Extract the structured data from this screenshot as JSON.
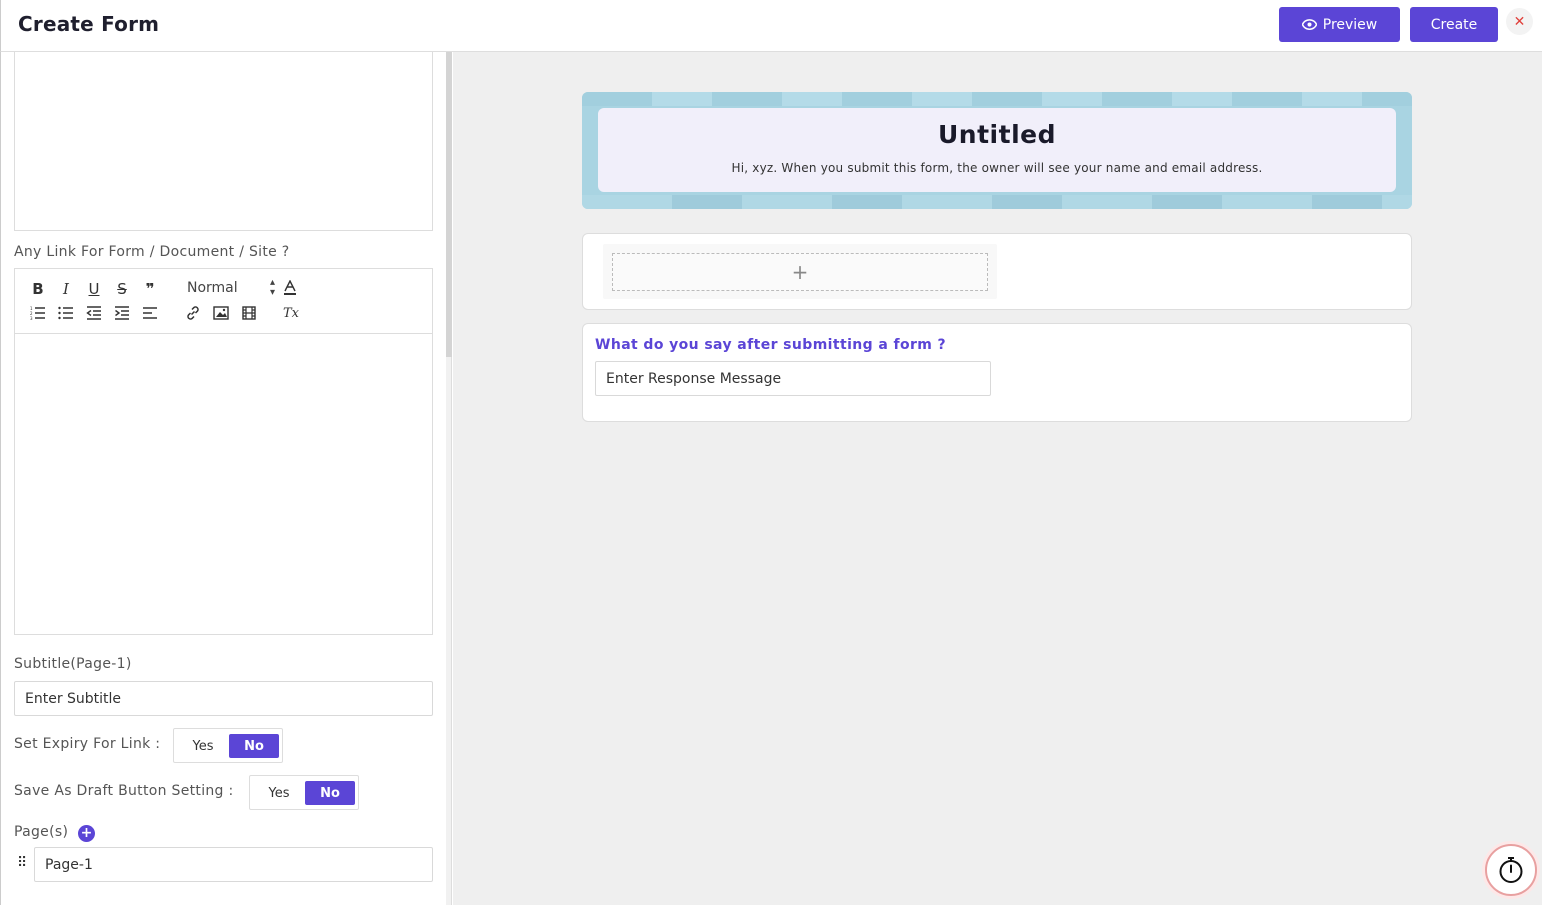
{
  "header": {
    "title": "Create Form",
    "preview_label": "Preview",
    "create_label": "Create",
    "close_glyph": "✕"
  },
  "sidebar": {
    "link_label": "Any Link For Form / Document / Site ?",
    "toolbar": {
      "bold": "B",
      "italic": "I",
      "underline": "U",
      "strike": "S",
      "quote": "❞",
      "format_select": "Normal",
      "clear_format": "Tx",
      "icons": [
        "bold-icon",
        "italic-icon",
        "underline-icon",
        "strikethrough-icon",
        "blockquote-icon",
        "font-color-icon",
        "ordered-list-icon",
        "bullet-list-icon",
        "outdent-icon",
        "indent-icon",
        "align-icon",
        "link-icon",
        "image-icon",
        "video-icon",
        "clear-format-icon"
      ]
    },
    "subtitle_label": "Subtitle(Page-1)",
    "subtitle_placeholder": "Enter Subtitle",
    "expiry_label": "Set Expiry For Link :",
    "expiry_yes": "Yes",
    "expiry_no": "No",
    "expiry_selected": "No",
    "draft_label": "Save As Draft Button Setting :",
    "draft_yes": "Yes",
    "draft_no": "No",
    "draft_selected": "No",
    "pages_label": "Page(s)",
    "add_page_glyph": "+",
    "drag_glyph": "⠿",
    "pages": [
      "Page-1"
    ]
  },
  "preview": {
    "form_title": "Untitled",
    "form_description": "Hi, xyz. When you submit this form, the owner will see your name and email address.",
    "add_glyph": "+",
    "response_question": "What do you say after submitting a form ?",
    "response_placeholder": "Enter Response Message"
  },
  "colors": {
    "accent": "#5b45d6",
    "banner": "#a9d4e2",
    "header_card": "#f1effa",
    "close": "#e0413c",
    "background": "#efefef"
  }
}
